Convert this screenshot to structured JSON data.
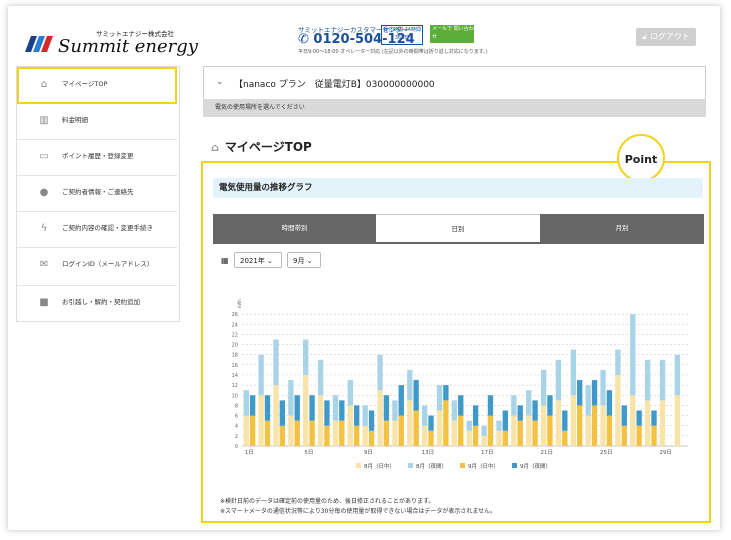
{
  "header": {
    "company_small": "サミットエナジー株式会社",
    "company_name": "Summit energy",
    "cc_title": "サミットエナジーカスタマーセンター",
    "cc_phone": "0120-504-124",
    "cc_hours": "受付時間 24時間365日",
    "cc_mail": "メールで 問い合わせ",
    "cc_note": "平日9:00〜18:00 オペレーター対応 (左記以外の時間帯は折り返し対応になります。)",
    "logout": "ログアウト"
  },
  "sidebar": {
    "items": [
      {
        "label": "マイページTOP",
        "icon": "home-icon",
        "glyph": "⌂"
      },
      {
        "label": "料金明細",
        "icon": "bar-chart-icon",
        "glyph": "▥"
      },
      {
        "label": "ポイント履歴・登録変更",
        "icon": "card-icon",
        "glyph": "▭"
      },
      {
        "label": "ご契約者情報・ご連絡先",
        "icon": "person-icon",
        "glyph": "●"
      },
      {
        "label": "ご契約内容の確認・変更手続き",
        "icon": "bolt-icon",
        "glyph": "ϟ"
      },
      {
        "label": "ログインID（メールアドレス）",
        "icon": "mail-icon",
        "glyph": "✉"
      },
      {
        "label": "お引越し・解約・契約追加",
        "icon": "truck-icon",
        "glyph": "■"
      }
    ]
  },
  "contract": {
    "label": "【nanaco プラン　従量電灯B】030000000000",
    "place_hint": "電気の使用場所を選んでください"
  },
  "page_title": "マイページTOP",
  "point_label": "Point",
  "graph_title": "電気使用量の推移グラフ",
  "tabs": [
    "時間帯別",
    "日別",
    "月別"
  ],
  "selectors": {
    "year": "2021年",
    "month": "9月"
  },
  "notes": [
    "※検針日前のデータは確定前の使用量のため、後日修正されることがあります。",
    "※スマートメータの通信状況等により30分毎の使用量が取得できない場合はデータが表示されません。"
  ],
  "colors": {
    "accent_yellow": "#f2d21b",
    "aug_day": "#f8e3a8",
    "aug_night": "#a9d4e8",
    "sep_day": "#f4c242",
    "sep_night": "#3f99c9"
  },
  "chart_data": {
    "type": "bar",
    "ylabel": "kWh",
    "ylim": [
      0,
      28
    ],
    "yticks": [
      0,
      2,
      4,
      6,
      8,
      10,
      12,
      14,
      16,
      18,
      20,
      22,
      24,
      26
    ],
    "x": [
      1,
      2,
      3,
      4,
      5,
      6,
      7,
      8,
      9,
      10,
      11,
      12,
      13,
      14,
      15,
      16,
      17,
      18,
      19,
      20,
      21,
      22,
      23,
      24,
      25,
      26,
      27,
      28,
      29,
      30
    ],
    "xtick_labels": [
      "1日",
      "5日",
      "9日",
      "13日",
      "17日",
      "21日",
      "25日",
      "29日"
    ],
    "xtick_positions": [
      1,
      5,
      9,
      13,
      17,
      21,
      25,
      29
    ],
    "series": [
      {
        "name": "8月（日中）",
        "color": "#f8e3a8",
        "values": [
          6,
          10,
          12,
          6,
          14,
          10,
          5,
          8,
          4,
          11,
          5,
          9,
          4,
          7,
          5,
          3,
          2,
          3,
          6,
          6,
          8,
          9,
          10,
          6,
          8,
          14,
          10,
          9,
          9,
          10
        ]
      },
      {
        "name": "8月（夜間）",
        "color": "#a9d4e8",
        "values": [
          5,
          8,
          9,
          7,
          7,
          7,
          5,
          5,
          4,
          7,
          4,
          6,
          4,
          5,
          4,
          2,
          2,
          2,
          4,
          5,
          7,
          8,
          9,
          6,
          7,
          5,
          16,
          8,
          8,
          8
        ]
      },
      {
        "name": "9月（日中）",
        "color": "#f4c242",
        "values": [
          6,
          5,
          4,
          5,
          5,
          4,
          5,
          4,
          3,
          5,
          6,
          7,
          3,
          9,
          6,
          4,
          6,
          3,
          5,
          5,
          6,
          3,
          8,
          8,
          6,
          4,
          4,
          4,
          0,
          0
        ]
      },
      {
        "name": "9月（夜間）",
        "color": "#3f99c9",
        "values": [
          4,
          5,
          5,
          5,
          5,
          5,
          4,
          4,
          4,
          5,
          6,
          6,
          3,
          3,
          4,
          4,
          4,
          4,
          3,
          4,
          4,
          4,
          5,
          5,
          5,
          4,
          3,
          3,
          0,
          0
        ]
      }
    ]
  }
}
